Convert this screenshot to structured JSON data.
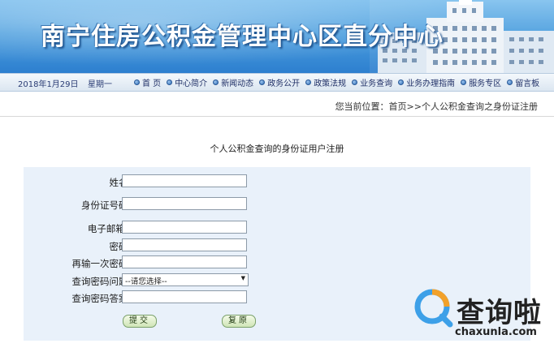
{
  "header": {
    "title": "南宁住房公积金管理中心区直分中心"
  },
  "nav": {
    "date": "2018年1月29日",
    "weekday": "星期一",
    "items": [
      {
        "label": "首 页"
      },
      {
        "label": "中心简介"
      },
      {
        "label": "新闻动态"
      },
      {
        "label": "政务公开"
      },
      {
        "label": "政策法规"
      },
      {
        "label": "业务查询"
      },
      {
        "label": "业务办理指南"
      },
      {
        "label": "服务专区"
      },
      {
        "label": "留言板"
      }
    ]
  },
  "breadcrumb": {
    "text": "您当前位置：首页>>个人公积金查询之身份证注册"
  },
  "form": {
    "title": "个人公积金查询的身份证用户注册",
    "fields": [
      {
        "label": "姓名：",
        "value": ""
      },
      {
        "label": "身份证号码：",
        "value": ""
      },
      {
        "label": "电子邮箱 ：",
        "value": ""
      },
      {
        "label": "密码：",
        "value": ""
      },
      {
        "label": "再输一次密码：",
        "value": ""
      },
      {
        "label": "查询密码问题：",
        "selected": "--请您选择--"
      },
      {
        "label": "查询密码答案：",
        "value": ""
      }
    ],
    "submit_label": "提交",
    "reset_label": "复原"
  },
  "watermark": {
    "name": "查询啦",
    "url": "chaxunla.com"
  },
  "colors": {
    "banner": "#4b9ede",
    "form_bg": "#e9f1fa",
    "nav_text": "#1f2f66"
  }
}
